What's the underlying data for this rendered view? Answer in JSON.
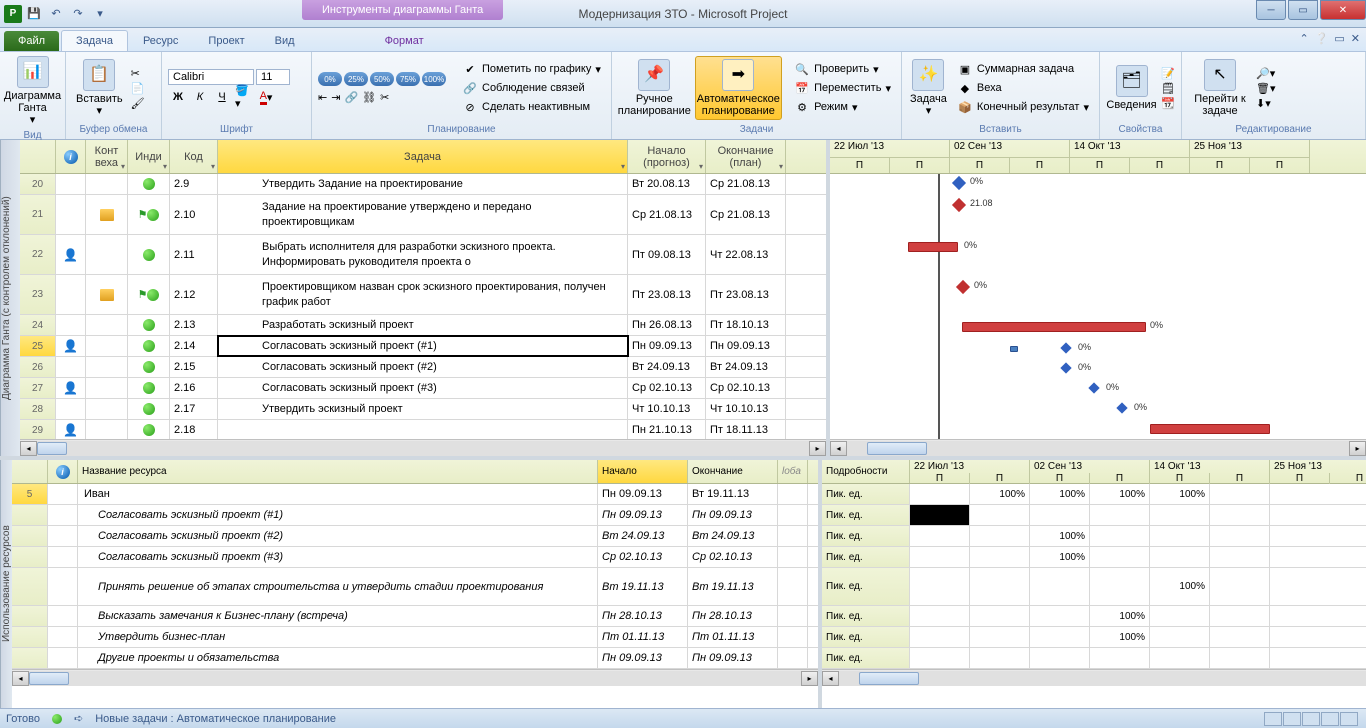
{
  "title": "Модернизация ЗТО  -  Microsoft Project",
  "contextual_tab": "Инструменты диаграммы Ганта",
  "tabs": {
    "file": "Файл",
    "task": "Задача",
    "resource": "Ресурс",
    "project": "Проект",
    "view": "Вид",
    "format": "Формат"
  },
  "ribbon": {
    "view_group": "Вид",
    "gantt_btn": "Диаграмма Ганта",
    "clipboard_group": "Буфер обмена",
    "paste_btn": "Вставить",
    "font_group": "Шрифт",
    "font_name": "Calibri",
    "font_size": "11",
    "schedule_group": "Планирование",
    "mark_track": "Пометить по графику",
    "respect_links": "Соблюдение связей",
    "inactivate": "Сделать неактивным",
    "tasks_group": "Задачи",
    "manual": "Ручное планирование",
    "auto": "Автоматическое планирование",
    "inspect": "Проверить",
    "move": "Переместить",
    "mode": "Режим",
    "insert_group": "Вставить",
    "task_btn": "Задача",
    "summary": "Суммарная задача",
    "milestone": "Веха",
    "deliverable": "Конечный результат",
    "props_group": "Свойства",
    "info": "Сведения",
    "editing_group": "Редактирование",
    "scroll_to": "Перейти к задаче"
  },
  "pct_btns": [
    "0%",
    "25%",
    "50%",
    "75%",
    "100%"
  ],
  "top_cols": {
    "info": "",
    "milestone": "Конт веха",
    "ind": "Инди",
    "code": "Код",
    "task": "Задача",
    "start": "Начало (прогноз)",
    "finish": "Окончание (план)"
  },
  "top_rows": [
    {
      "n": "20",
      "code": "2.9",
      "task": "Утвердить Задание на проектирование",
      "start": "Вт 20.08.13",
      "finish": "Ср 21.08.13",
      "dot": true
    },
    {
      "n": "21",
      "code": "2.10",
      "task": "Задание на проектирование утверждено и передано проектировщикам",
      "start": "Ср 21.08.13",
      "finish": "Ср 21.08.13",
      "dot": true,
      "note": true,
      "flag": true,
      "tall": true
    },
    {
      "n": "22",
      "code": "2.11",
      "task": "Выбрать исполнителя для разработки эскизного проекта. Информировать руководителя проекта о",
      "start": "Пт 09.08.13",
      "finish": "Чт 22.08.13",
      "dot": true,
      "person": true,
      "tall": true
    },
    {
      "n": "23",
      "code": "2.12",
      "task": "Проектировщиком назван срок эскизного проектирования, получен график работ",
      "start": "Пт 23.08.13",
      "finish": "Пт 23.08.13",
      "dot": true,
      "note": true,
      "flag": true,
      "tall": true
    },
    {
      "n": "24",
      "code": "2.13",
      "task": "Разработать эскизный проект",
      "start": "Пн 26.08.13",
      "finish": "Пт 18.10.13",
      "dot": true
    },
    {
      "n": "25",
      "code": "2.14",
      "task": "Согласовать эскизный проект (#1)",
      "start": "Пн 09.09.13",
      "finish": "Пн 09.09.13",
      "dot": true,
      "person": true,
      "sel": true
    },
    {
      "n": "26",
      "code": "2.15",
      "task": "Согласовать эскизный проект (#2)",
      "start": "Вт 24.09.13",
      "finish": "Вт 24.09.13",
      "dot": true
    },
    {
      "n": "27",
      "code": "2.16",
      "task": "Согласовать эскизный проект (#3)",
      "start": "Ср 02.10.13",
      "finish": "Ср 02.10.13",
      "dot": true,
      "person": true
    },
    {
      "n": "28",
      "code": "2.17",
      "task": "Утвердить эскизный проект",
      "start": "Чт 10.10.13",
      "finish": "Чт 10.10.13",
      "dot": true
    },
    {
      "n": "29",
      "code": "2.18",
      "task": "",
      "start": "Пн 21.10.13",
      "finish": "Пт 18.11.13",
      "dot": true,
      "person": true
    }
  ],
  "timeline_months": [
    "22 Июл '13",
    "02 Сен '13",
    "14 Окт '13",
    "25 Ноя '13"
  ],
  "timeline_day": "П",
  "gantt_milestone_label": "21.08",
  "pct_label": "0%",
  "bot_cols": {
    "info": "",
    "name": "Название ресурса",
    "start": "Начало",
    "finish": "Окончание",
    "add": "loба"
  },
  "bot_rownum": "5",
  "bot_rows": [
    {
      "name": "Иван",
      "start": "Пн 09.09.13",
      "finish": "Вт 19.11.13",
      "italic": false
    },
    {
      "name": "Согласовать эскизный проект (#1)",
      "start": "Пн 09.09.13",
      "finish": "Пн 09.09.13",
      "italic": true
    },
    {
      "name": "Согласовать эскизный проект (#2)",
      "start": "Вт 24.09.13",
      "finish": "Вт 24.09.13",
      "italic": true
    },
    {
      "name": "Согласовать эскизный проект (#3)",
      "start": "Ср 02.10.13",
      "finish": "Ср 02.10.13",
      "italic": true
    },
    {
      "name": "Принять решение об этапах строительства  и утвердить стадии проектирования",
      "start": "Вт 19.11.13",
      "finish": "Вт 19.11.13",
      "italic": true,
      "tall": true
    },
    {
      "name": "Высказать замечания к Бизнес-плану (встреча)",
      "start": "Пн 28.10.13",
      "finish": "Пн 28.10.13",
      "italic": true
    },
    {
      "name": "Утвердить бизнес-план",
      "start": "Пт 01.11.13",
      "finish": "Пт 01.11.13",
      "italic": true
    },
    {
      "name": "Другие проекты и обязательства",
      "start": "Пн 09.09.13",
      "finish": "Пн 09.09.13",
      "italic": true
    }
  ],
  "details_label": "Подробности",
  "details_row": "Пик. ед.",
  "detail_vals": [
    [
      "",
      "100%",
      "100%",
      "100%",
      "100%",
      ""
    ],
    [
      "",
      "",
      "",
      "",
      "",
      ""
    ],
    [
      "",
      "",
      "100%",
      "",
      "",
      ""
    ],
    [
      "",
      "",
      "100%",
      "",
      "",
      ""
    ],
    [
      "",
      "",
      "",
      "",
      "100%",
      ""
    ],
    [
      "",
      "",
      "",
      "100%",
      "",
      ""
    ],
    [
      "",
      "",
      "",
      "100%",
      "",
      ""
    ],
    [
      "",
      "",
      "",
      "",
      "",
      ""
    ]
  ],
  "vlabel_top": "Диаграмма Ганта (с контролем отклонений)",
  "vlabel_bot": "Использование ресурсов",
  "status_ready": "Готово",
  "status_mode": "Новые задачи : Автоматическое планирование"
}
